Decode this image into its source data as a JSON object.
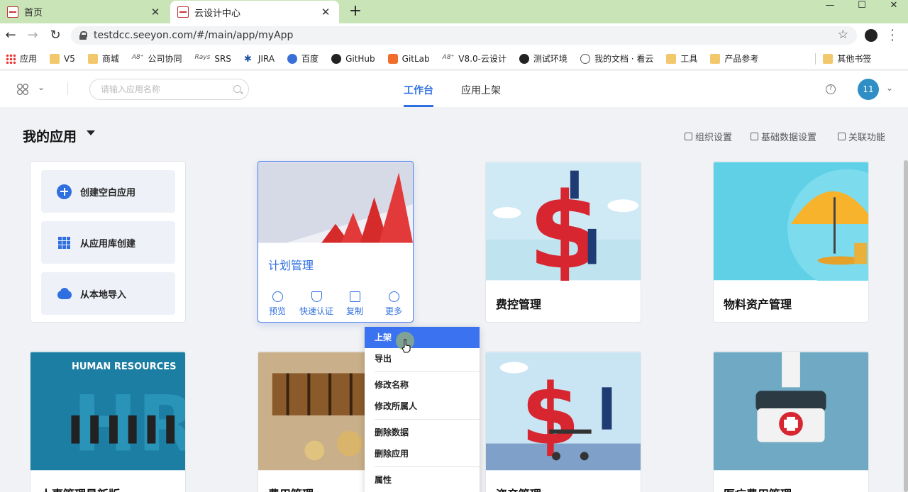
{
  "browser": {
    "tabs": [
      {
        "title": "首页",
        "active": false
      },
      {
        "title": "云设计中心",
        "active": true
      }
    ],
    "url": "testdcc.seeyon.com/#/main/app/myApp",
    "bookmarks": [
      "应用",
      "V5",
      "商城",
      "公司协同",
      "SRS",
      "JIRA",
      "百度",
      "GitHub",
      "GitLab",
      "V8.0-云设计",
      "测试环境",
      "我的文档 · 看云",
      "工具",
      "产品参考"
    ],
    "other_bookmarks": "其他书签",
    "bookmark_prefixes": {
      "a8_1": "A8⁺",
      "srs": "Rays",
      "a8_2": "A8⁺"
    }
  },
  "header": {
    "search_placeholder": "请输入应用名称",
    "tabs": [
      "工作台",
      "应用上架"
    ],
    "active_tab": "工作台",
    "avatar": "11"
  },
  "main": {
    "title": "我的应用",
    "links": [
      "组织设置",
      "基础数据设置",
      "关联功能"
    ],
    "create_options": [
      "创建空白应用",
      "从应用库创建",
      "从本地导入"
    ],
    "apps": [
      {
        "name": "计划管理",
        "hovered": true
      },
      {
        "name": "费控管理"
      },
      {
        "name": "物料资产管理"
      },
      {
        "name": "人事管理最新版",
        "image_text": "HUMAN RESOURCES"
      },
      {
        "name": "费用管理"
      },
      {
        "name": "资产管理"
      },
      {
        "name": "医疗费用管理"
      }
    ],
    "card_actions": [
      "预览",
      "快速认证",
      "复制",
      "更多"
    ]
  },
  "context_menu": {
    "items": [
      "上架",
      "导出",
      "修改名称",
      "修改所属人",
      "删除数据",
      "删除应用",
      "属性"
    ],
    "highlighted": "上架"
  },
  "colors": {
    "accent": "#2f6fe0",
    "menu_highlight": "#3a72ef",
    "tabbar": "#c9e5b8"
  }
}
